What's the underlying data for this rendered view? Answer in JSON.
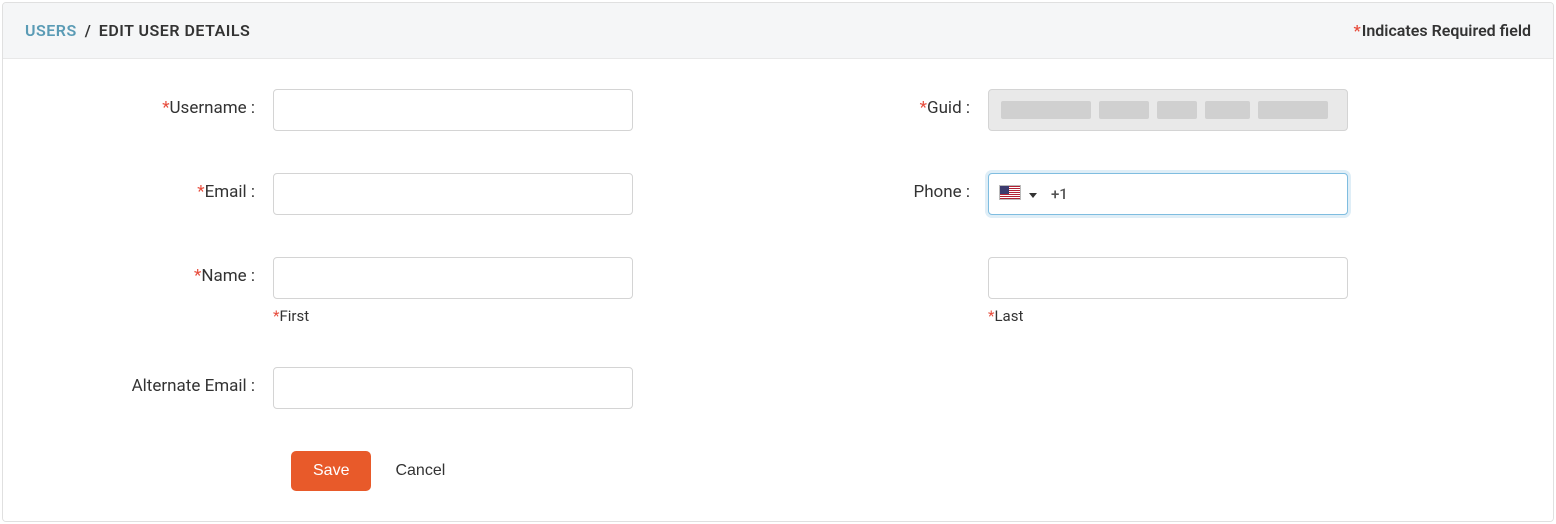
{
  "header": {
    "breadcrumb_parent": "USERS",
    "breadcrumb_separator": "/",
    "breadcrumb_current": "EDIT USER DETAILS",
    "required_note": "Indicates Required field"
  },
  "form": {
    "labels": {
      "username": "Username :",
      "guid": "Guid :",
      "email": "Email :",
      "phone": "Phone :",
      "name": "Name :",
      "first": "First",
      "last": "Last",
      "alternate_email": "Alternate Email :"
    },
    "values": {
      "username": "",
      "guid": "",
      "email": "",
      "phone_prefix": "+1",
      "phone": "",
      "first_name": "",
      "last_name": "",
      "alternate_email": ""
    },
    "phone_country": "us"
  },
  "buttons": {
    "save": "Save",
    "cancel": "Cancel"
  }
}
